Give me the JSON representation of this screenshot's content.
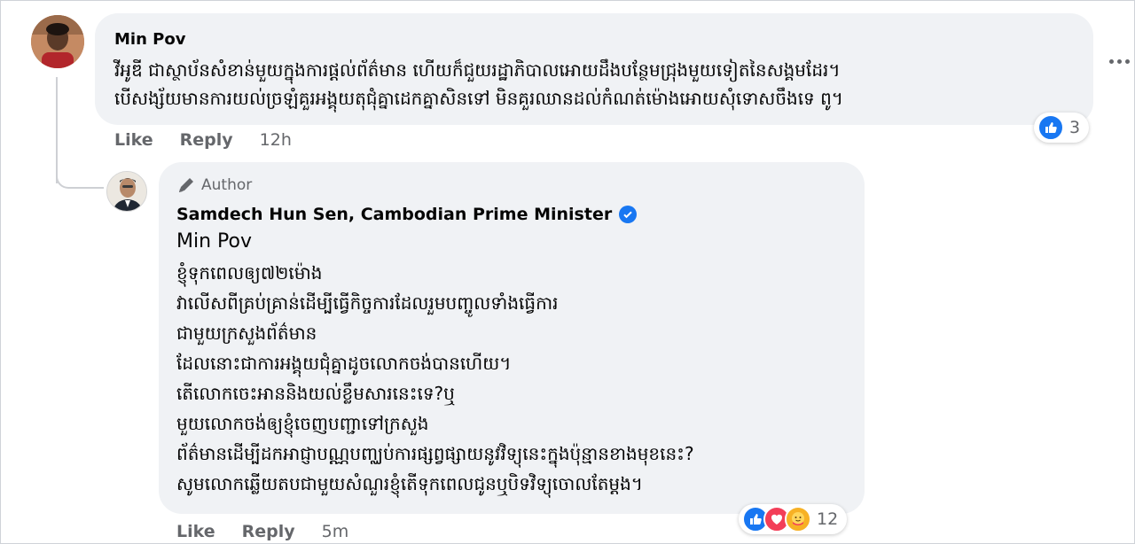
{
  "comment": {
    "author": "Min Pov",
    "lines": [
      "វីអូឌី ជាស្ថាប័នសំខាន់មួយក្នុងការផ្តល់ព័ត៌មាន ហើយក៏ជួយរដ្ឋាភិបាលអោយដឹងបន្ថែមជ្រុងមួយទៀតនៃសង្គមដែរ។",
      "បើសង្ស័យមានការយល់ច្រឡំគួរអង្គុយតុជុំគ្នាដេកគ្នាសិនទៅ មិនគួរឈានដល់កំណត់ម៉ោងអោយសុំទោសចឹងទេ ពូ។"
    ],
    "like_label": "Like",
    "reply_label": "Reply",
    "time": "12h",
    "reaction_count": "3"
  },
  "reply": {
    "badge": "Author",
    "author": "Samdech Hun Sen, Cambodian Prime Minister",
    "mention": "Min Pov",
    "lines": [
      "ខ្ញុំទុកពេលឲ្យ៧២ម៉ោង",
      "វាលើសពីគ្រប់គ្រាន់ដើម្បីធ្វើកិច្ចការដែលរួមបញ្ចូលទាំងធ្វើការ",
      "ជាមួយក្រសួងព័ត៌មាន",
      "ដែលនោះជាការអង្គុយជុំគ្នាដូចលោកចង់បានហើយ។",
      "តើលោកចេះអាននិងយល់ខ្លឹមសារនេះទេ?ឬ",
      "មួយលោកចង់ឲ្យខ្ញុំចេញបញ្ជាទៅក្រសួង",
      "ព័ត៌មានដើម្បីដកអាជ្ញាបណ្ណបញ្ឈប់ការផ្សព្វផ្សាយនូវវិទ្យុនេះក្នុងប៉ុន្មានខាងមុខនេះ?",
      "សូមលោកឆ្លើយតបជាមួយសំណួរខ្ញុំតើទុកពេលជូនឬបិទវិទ្យុចោលតែម្តង។"
    ],
    "like_label": "Like",
    "reply_label": "Reply",
    "time": "5m",
    "reaction_count": "12"
  },
  "icons": {
    "verified": "verified-badge-icon",
    "author_badge": "pen-icon",
    "reactions": [
      "like-reaction-icon",
      "love-reaction-icon",
      "care-reaction-icon"
    ],
    "more": "more-options-icon"
  },
  "colors": {
    "bubble": "#f0f2f5",
    "secondary_text": "#65676b",
    "like_blue": "#1877f2",
    "love_red": "#f33e58",
    "care_yellow": "#f7b125"
  }
}
